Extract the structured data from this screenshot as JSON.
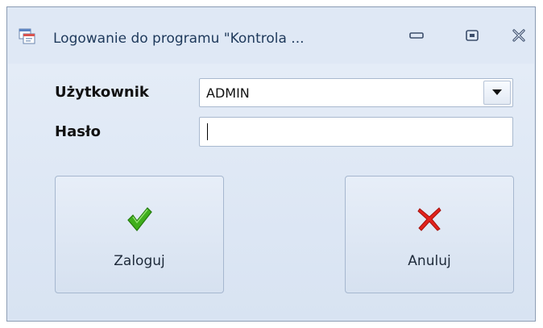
{
  "window": {
    "title": "Logowanie do programu \"Kontrola ...",
    "icons": {
      "app": "app-icon",
      "minimize": "minimize-icon",
      "maximize": "maximize-icon",
      "close": "close-icon"
    }
  },
  "form": {
    "user_label": "Użytkownik",
    "user_value": "ADMIN",
    "password_label": "Hasło",
    "password_value": ""
  },
  "buttons": {
    "login_label": "Zaloguj",
    "cancel_label": "Anuluj"
  },
  "colors": {
    "accent_green": "#3fae1c",
    "accent_red": "#e3221c",
    "title_text": "#1e395b"
  }
}
